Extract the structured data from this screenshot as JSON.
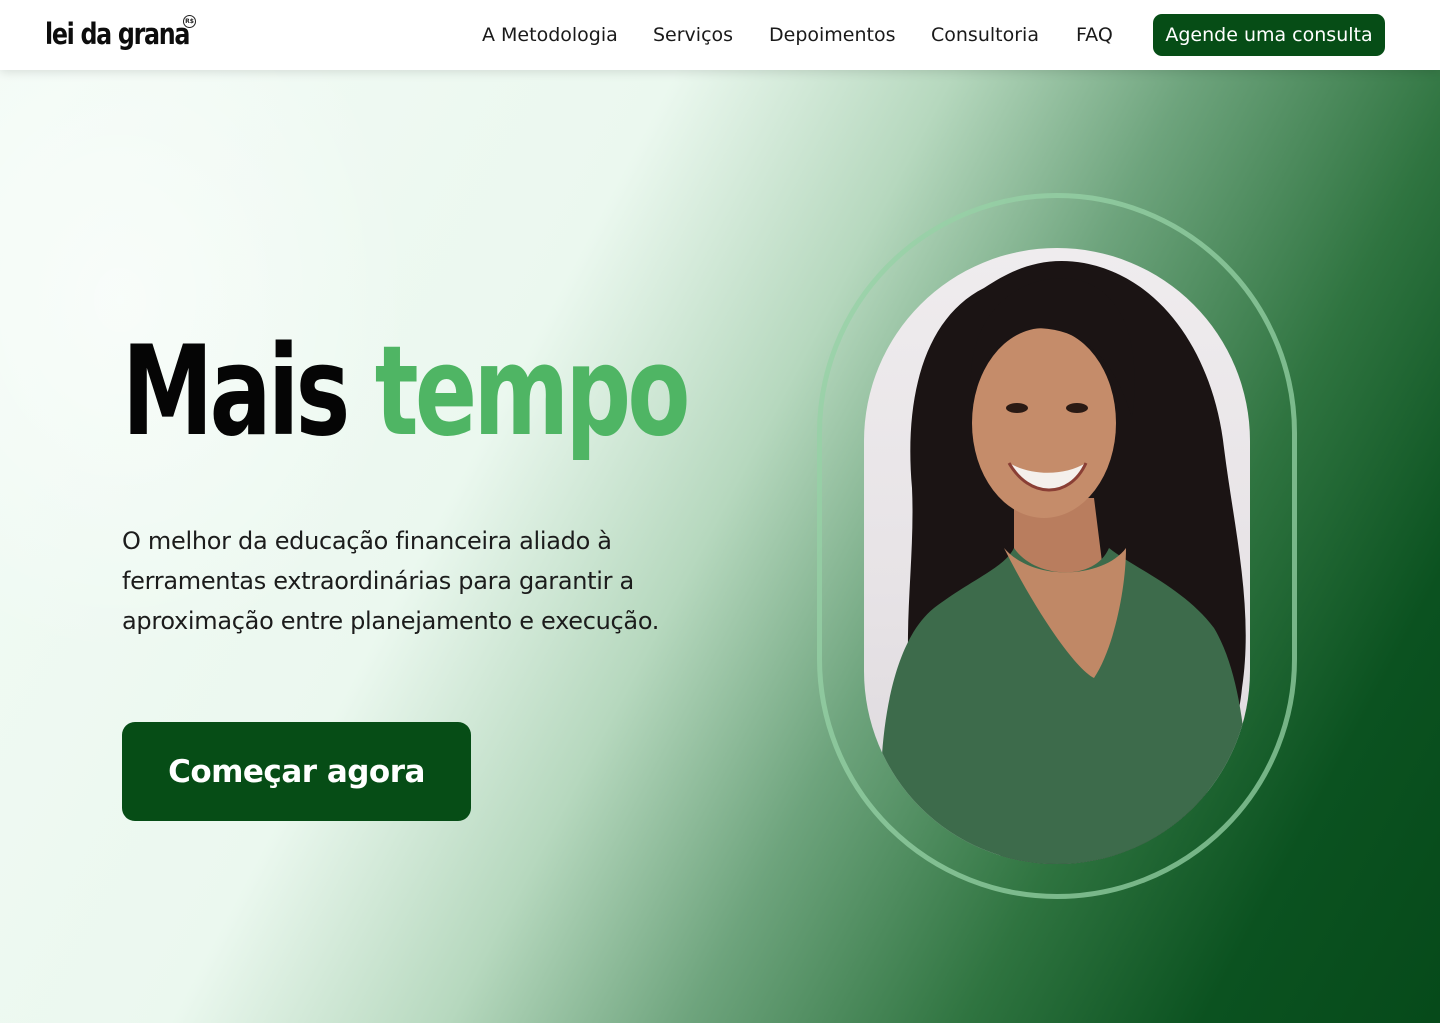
{
  "brand": {
    "name": "lei da grana",
    "badge": "R$"
  },
  "nav": {
    "items": [
      {
        "label": "A Metodologia"
      },
      {
        "label": "Serviços"
      },
      {
        "label": "Depoimentos"
      },
      {
        "label": "Consultoria"
      },
      {
        "label": "FAQ"
      }
    ],
    "cta_label": "Agende uma consulta"
  },
  "hero": {
    "headline_word1": "Mais",
    "headline_word2": "tempo",
    "lead": "O melhor da educação financeira aliado à ferramentas extraordinárias para garantir a aproximação entre planejamento e execução.",
    "cta_label": "Começar agora"
  },
  "colors": {
    "primary_dark_green": "#064d16",
    "accent_green": "#4fb564",
    "ring_green": "#96d2a5"
  },
  "icons": {
    "brand_badge": "currency-badge-icon"
  }
}
